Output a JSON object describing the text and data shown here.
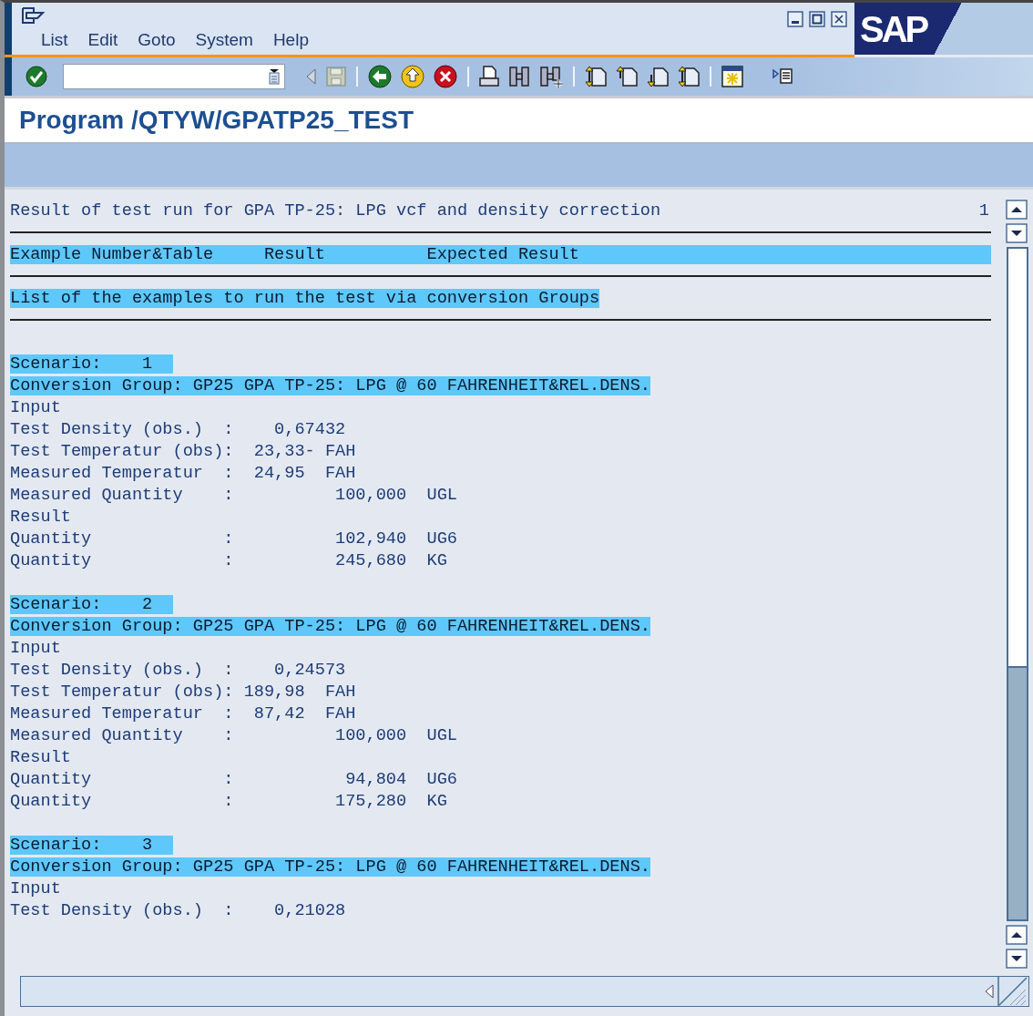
{
  "menu": [
    "List",
    "Edit",
    "Goto",
    "System",
    "Help"
  ],
  "logo": "SAP",
  "title": "Program /QTYW/GPATP25_TEST",
  "list": {
    "page": "1",
    "lines": [
      {
        "kind": "text",
        "text": "Result of test run for GPA TP-25: LPG vcf and density correction"
      },
      {
        "kind": "rule"
      },
      {
        "kind": "header",
        "text": "Example Number&Table     Result          Expected Result"
      },
      {
        "kind": "rule"
      },
      {
        "kind": "highlight",
        "text": "List of the examples to run the test via conversion Groups"
      },
      {
        "kind": "rule"
      },
      {
        "kind": "blank"
      },
      {
        "kind": "highlight",
        "text": "Scenario:    1  "
      },
      {
        "kind": "highlight",
        "text": "Conversion Group: GP25 GPA TP-25: LPG @ 60 FAHRENHEIT&REL.DENS."
      },
      {
        "kind": "text",
        "text": "Input"
      },
      {
        "kind": "text",
        "text": "Test Density (obs.)  :    0,67432"
      },
      {
        "kind": "text",
        "text": "Test Temperatur (obs):  23,33- FAH"
      },
      {
        "kind": "text",
        "text": "Measured Temperatur  :  24,95  FAH"
      },
      {
        "kind": "text",
        "text": "Measured Quantity    :          100,000  UGL"
      },
      {
        "kind": "text",
        "text": "Result"
      },
      {
        "kind": "text",
        "text": "Quantity             :          102,940  UG6"
      },
      {
        "kind": "text",
        "text": "Quantity             :          245,680  KG"
      },
      {
        "kind": "blank"
      },
      {
        "kind": "highlight",
        "text": "Scenario:    2  "
      },
      {
        "kind": "highlight",
        "text": "Conversion Group: GP25 GPA TP-25: LPG @ 60 FAHRENHEIT&REL.DENS."
      },
      {
        "kind": "text",
        "text": "Input"
      },
      {
        "kind": "text",
        "text": "Test Density (obs.)  :    0,24573"
      },
      {
        "kind": "text",
        "text": "Test Temperatur (obs): 189,98  FAH"
      },
      {
        "kind": "text",
        "text": "Measured Temperatur  :  87,42  FAH"
      },
      {
        "kind": "text",
        "text": "Measured Quantity    :          100,000  UGL"
      },
      {
        "kind": "text",
        "text": "Result"
      },
      {
        "kind": "text",
        "text": "Quantity             :           94,804  UG6"
      },
      {
        "kind": "text",
        "text": "Quantity             :          175,280  KG"
      },
      {
        "kind": "blank"
      },
      {
        "kind": "highlight",
        "text": "Scenario:    3  "
      },
      {
        "kind": "highlight",
        "text": "Conversion Group: GP25 GPA TP-25: LPG @ 60 FAHRENHEIT&REL.DENS."
      },
      {
        "kind": "text",
        "text": "Input"
      },
      {
        "kind": "text",
        "text": "Test Density (obs.)  :    0,21028"
      }
    ]
  }
}
